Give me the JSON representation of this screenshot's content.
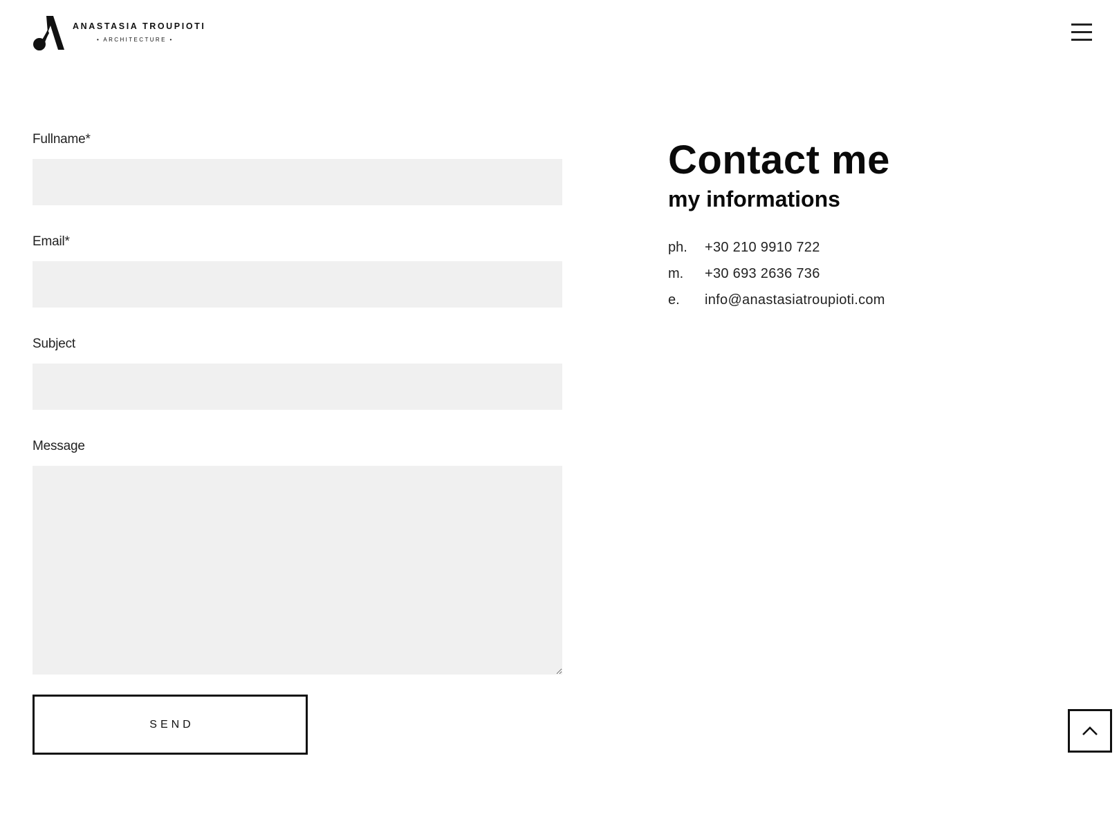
{
  "header": {
    "logo_name": "ANASTASIA TROUPIOTI",
    "logo_sub": "• ARCHITECTURE •",
    "menu_icon": "hamburger-menu-icon"
  },
  "form": {
    "fullname_label": "Fullname*",
    "fullname_value": "",
    "email_label": "Email*",
    "email_value": "",
    "subject_label": "Subject",
    "subject_value": "",
    "message_label": "Message",
    "message_value": "",
    "send_label": "SEND"
  },
  "contact": {
    "title": "Contact me",
    "subtitle": "my informations",
    "items": [
      {
        "key": "ph.",
        "value": "+30 210 9910 722"
      },
      {
        "key": "m.",
        "value": "+30 693 2636 736"
      },
      {
        "key": "e.",
        "value": "info@anastasiatroupioti.com"
      }
    ]
  },
  "back_to_top_icon": "chevron-up-icon",
  "colors": {
    "text": "#111111",
    "field_background": "#f0f0f0",
    "page_background": "#ffffff"
  }
}
